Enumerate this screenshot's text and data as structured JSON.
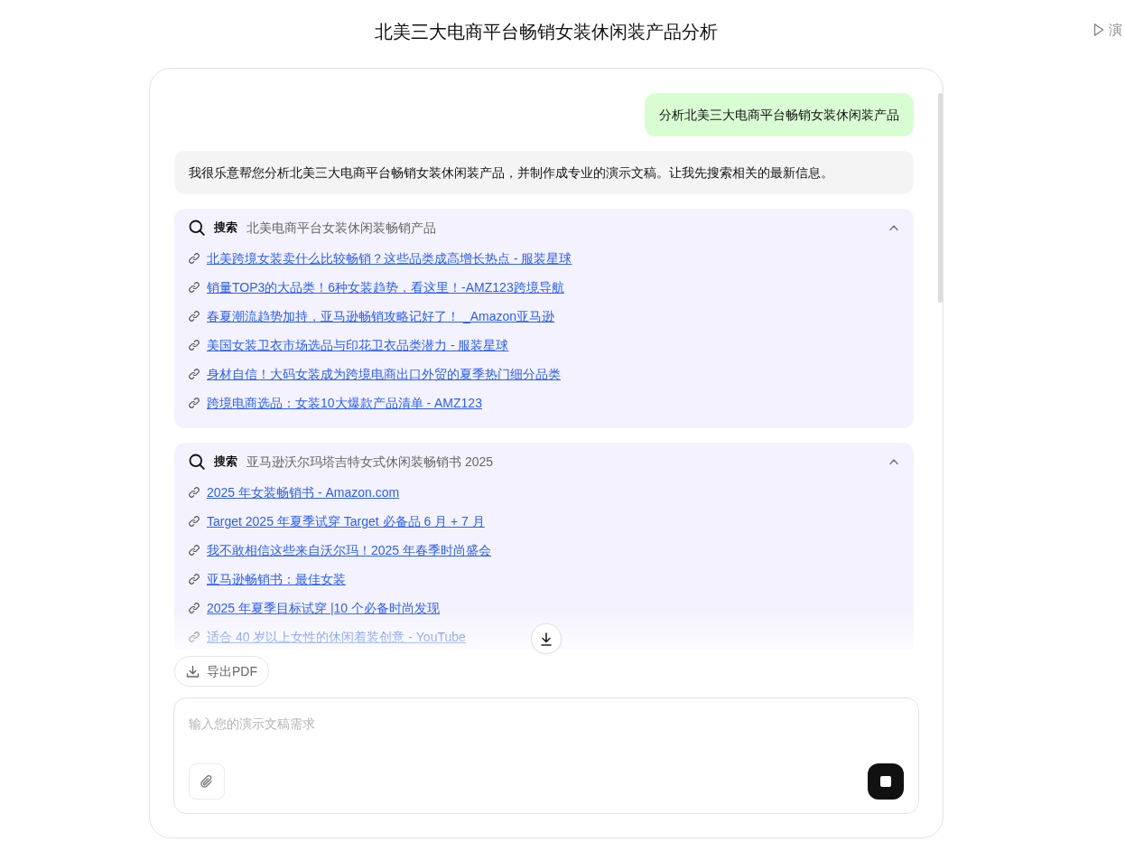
{
  "header": {
    "title": "北美三大电商平台畅销女装休闲装产品分析"
  },
  "side_tab": {
    "label": "演"
  },
  "messages": [
    {
      "kind": "user",
      "text": "分析北美三大电商平台畅销女装休闲装产品"
    },
    {
      "kind": "assistant",
      "text": "我很乐意帮您分析北美三大电商平台畅销女装休闲装产品，并制作成专业的演示文稿。让我先搜索相关的最新信息。"
    },
    {
      "kind": "search",
      "label": "搜索",
      "query": "北美电商平台女装休闲装畅销产品",
      "expanded": true,
      "results": [
        "北美跨境女装卖什么比较畅销？这些品类成高增长热点 - 服装星球",
        "销量TOP3的大品类！6种女装趋势，看这里！-AMZ123跨境导航",
        "春夏潮流趋势加持，亚马逊畅销攻略记好了！ _Amazon亚马逊",
        "美国女装卫衣市场选品与印花卫衣品类潜力 - 服装星球",
        "身材自信！大码女装成为跨境电商出口外贸的夏季热门细分品类",
        "跨境电商选品：女装10大爆款产品清单 - AMZ123"
      ]
    },
    {
      "kind": "search",
      "label": "搜索",
      "query": "亚马逊沃尔玛塔吉特女式休闲装畅销书 2025",
      "expanded": true,
      "results": [
        "2025 年女装畅销书 - Amazon.com",
        "Target 2025 年夏季试穿 Target 必备品 6 月 + 7 月",
        "我不敢相信这些来自沃尔玛！2025 年春季时尚盛会",
        "亚马逊畅销书：最佳女装",
        "2025 年夏季目标试穿 |10 个必备时尚发现",
        "适合 40 岁以上女性的休闲着装创意 - YouTube"
      ]
    }
  ],
  "export_button": {
    "label": "导出PDF"
  },
  "composer": {
    "placeholder": "输入您的演示文稿需求",
    "generating": true
  }
}
